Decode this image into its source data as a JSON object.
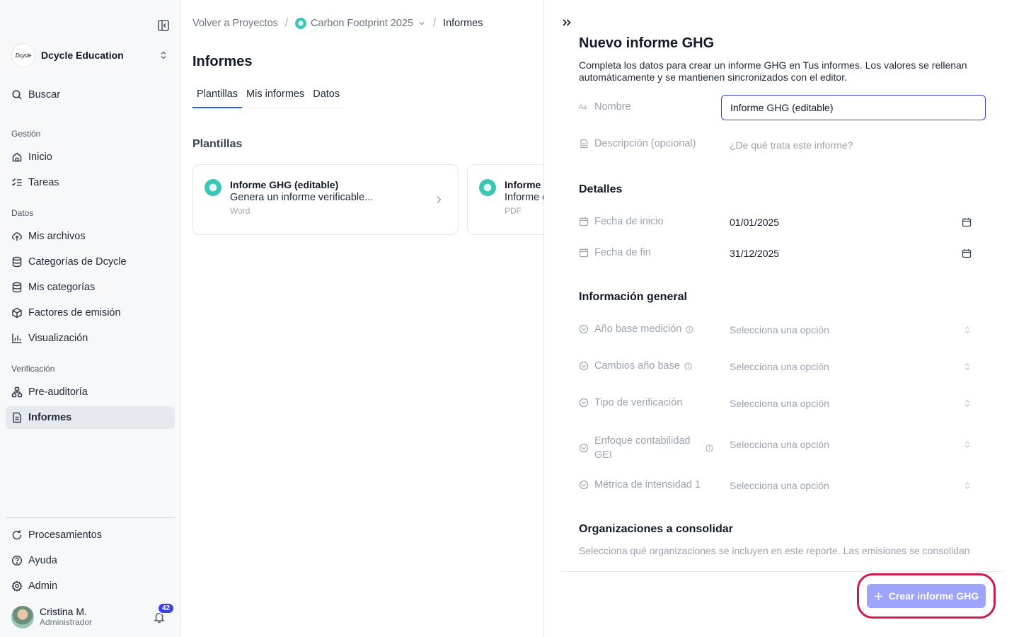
{
  "sidebar": {
    "org_logo_text": "Dcycle",
    "org_name": "Dcycle Education",
    "search_label": "Buscar",
    "sections": {
      "gestion": "Gestión",
      "datos": "Datos",
      "verificacion": "Verificación"
    },
    "items": {
      "inicio": "Inicio",
      "tareas": "Tareas",
      "mis_archivos": "Mis archivos",
      "categorias_dcycle": "Categorías de Dcycle",
      "mis_categorias": "Mis categorías",
      "factores": "Factores de emisión",
      "visualizacion": "Visualización",
      "preauditoria": "Pre-auditoría",
      "informes": "Informes",
      "procesamientos": "Procesamientos",
      "ayuda": "Ayuda",
      "admin": "Admin"
    },
    "user": {
      "name": "Cristina M.",
      "role": "Administrador",
      "notifications": "42"
    }
  },
  "breadcrumb": {
    "back": "Volver a Proyectos",
    "project": "Carbon Footprint 2025",
    "current": "Informes"
  },
  "main": {
    "title": "Informes",
    "tabs": [
      "Plantillas",
      "Mis informes",
      "Datos"
    ],
    "section_title": "Plantillas",
    "cards": [
      {
        "title": "Informe GHG (editable)",
        "desc": "Genera un informe verificable...",
        "type": "Word"
      },
      {
        "title": "Informe GHG",
        "desc": "Informe estándar en PDF",
        "type": "PDF"
      }
    ]
  },
  "panel": {
    "title": "Nuevo informe GHG",
    "description": "Completa los datos para crear un informe GHG en Tus informes. Los valores se rellenan automáticamente y se mantienen sincronizados con el editor.",
    "name_label": "Nombre",
    "name_value": "Informe GHG (editable)",
    "desc_label": "Descripción (opcional)",
    "desc_placeholder": "¿De qué trata este informe?",
    "details_title": "Detalles",
    "start_label": "Fecha de inicio",
    "start_value": "01/01/2025",
    "end_label": "Fecha de fin",
    "end_value": "31/12/2025",
    "general_title": "Información general",
    "select_placeholder": "Selecciona una opción",
    "fields": {
      "ano_base": "Año base medición",
      "cambios": "Cambios año base",
      "tipo": "Tipo de verificación",
      "enfoque_1": "Enfoque contabilidad",
      "enfoque_2": "GEI",
      "metrica": "Métrica de intensidad 1"
    },
    "orgs_title": "Organizaciones a consolidar",
    "orgs_desc": "Selecciona qué organizaciones se incluyen en este reporte. Las emisiones se consolidan",
    "create_button": "Crear informe GHG"
  },
  "colors": {
    "accent": "#3b3ff0",
    "button_disabled": "#9ea3fb",
    "highlight": "#d11a4b",
    "teal": "#3cc6b4"
  }
}
